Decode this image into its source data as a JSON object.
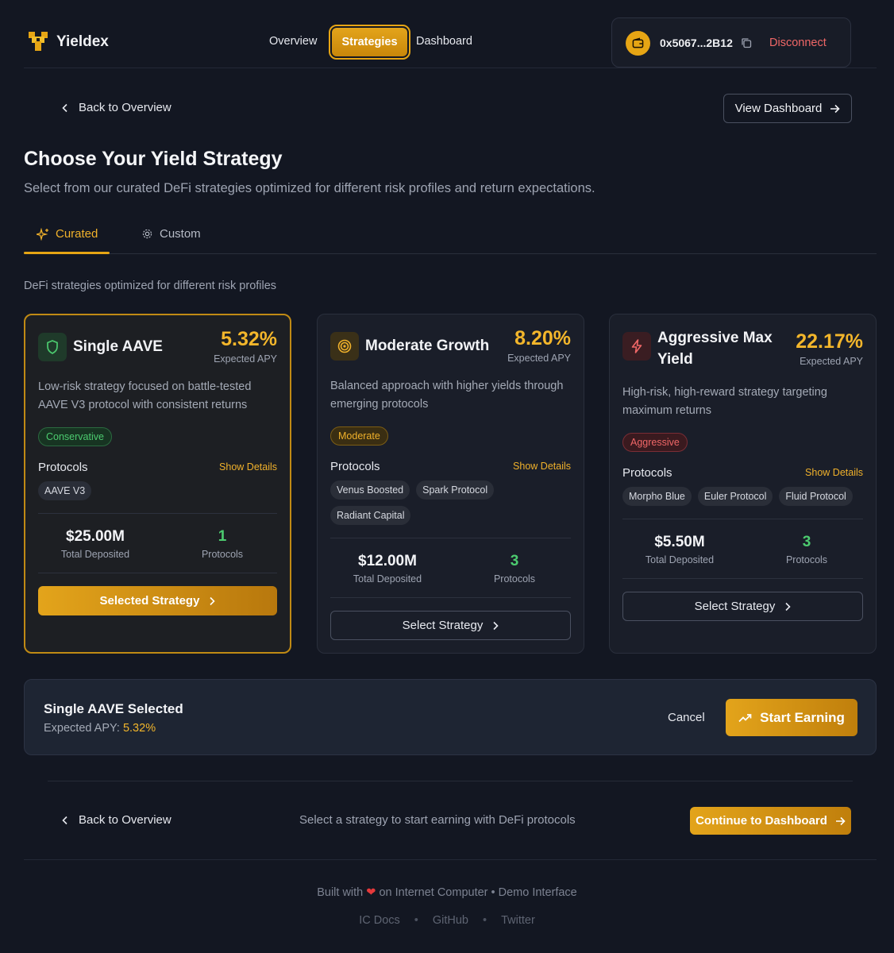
{
  "header": {
    "brand": "Yieldex",
    "nav": [
      "Overview",
      "Strategies",
      "Dashboard"
    ],
    "wallet_address": "0x5067...2B12",
    "disconnect_label": "Disconnect"
  },
  "top_actions": {
    "back_label": "Back to Overview",
    "view_dashboard_label": "View Dashboard"
  },
  "page": {
    "title": "Choose Your Yield Strategy",
    "subtitle": "Select from our curated DeFi strategies optimized for different risk profiles and return expectations."
  },
  "tabs": [
    {
      "label": "Curated",
      "active": true
    },
    {
      "label": "Custom",
      "active": false
    }
  ],
  "section_subtitle": "DeFi strategies optimized for different risk profiles",
  "strategies": [
    {
      "name": "Single AAVE",
      "apy": "5.32%",
      "apy_label": "Expected APY",
      "description": "Low-risk strategy focused on battle-tested AAVE V3 protocol with consistent returns",
      "risk": "Conservative",
      "protocols_label": "Protocols",
      "show_details_label": "Show Details",
      "protocols": [
        "AAVE V3"
      ],
      "total_deposited": "$25.00M",
      "total_deposited_label": "Total Deposited",
      "protocol_count": "1",
      "protocol_count_label": "Protocols",
      "button_label": "Selected Strategy",
      "selected": true
    },
    {
      "name": "Moderate Growth",
      "apy": "8.20%",
      "apy_label": "Expected APY",
      "description": "Balanced approach with higher yields through emerging protocols",
      "risk": "Moderate",
      "protocols_label": "Protocols",
      "show_details_label": "Show Details",
      "protocols": [
        "Venus Boosted",
        "Spark Protocol",
        "Radiant Capital"
      ],
      "total_deposited": "$12.00M",
      "total_deposited_label": "Total Deposited",
      "protocol_count": "3",
      "protocol_count_label": "Protocols",
      "button_label": "Select Strategy",
      "selected": false
    },
    {
      "name": "Aggressive Max Yield",
      "apy": "22.17%",
      "apy_label": "Expected APY",
      "description": "High-risk, high-reward strategy targeting maximum returns",
      "risk": "Aggressive",
      "protocols_label": "Protocols",
      "show_details_label": "Show Details",
      "protocols": [
        "Morpho Blue",
        "Euler Protocol",
        "Fluid Protocol"
      ],
      "total_deposited": "$5.50M",
      "total_deposited_label": "Total Deposited",
      "protocol_count": "3",
      "protocol_count_label": "Protocols",
      "button_label": "Select Strategy",
      "selected": false
    }
  ],
  "selection": {
    "title": "Single AAVE Selected",
    "apy_label": "Expected APY:",
    "apy_value": "5.32%",
    "cancel_label": "Cancel",
    "start_label": "Start Earning"
  },
  "bottom": {
    "back_label": "Back to Overview",
    "hint": "Select a strategy to start earning with DeFi protocols",
    "continue_label": "Continue to Dashboard"
  },
  "footer": {
    "built_prefix": "Built with",
    "built_suffix": "on Internet Computer • Demo Interface",
    "links": [
      "IC Docs",
      "GitHub",
      "Twitter"
    ]
  },
  "colors": {
    "background": "#131722",
    "accent": "#e6a514",
    "apy": "#f3b62b",
    "positive": "#4ccb6f",
    "danger": "#f06767"
  }
}
